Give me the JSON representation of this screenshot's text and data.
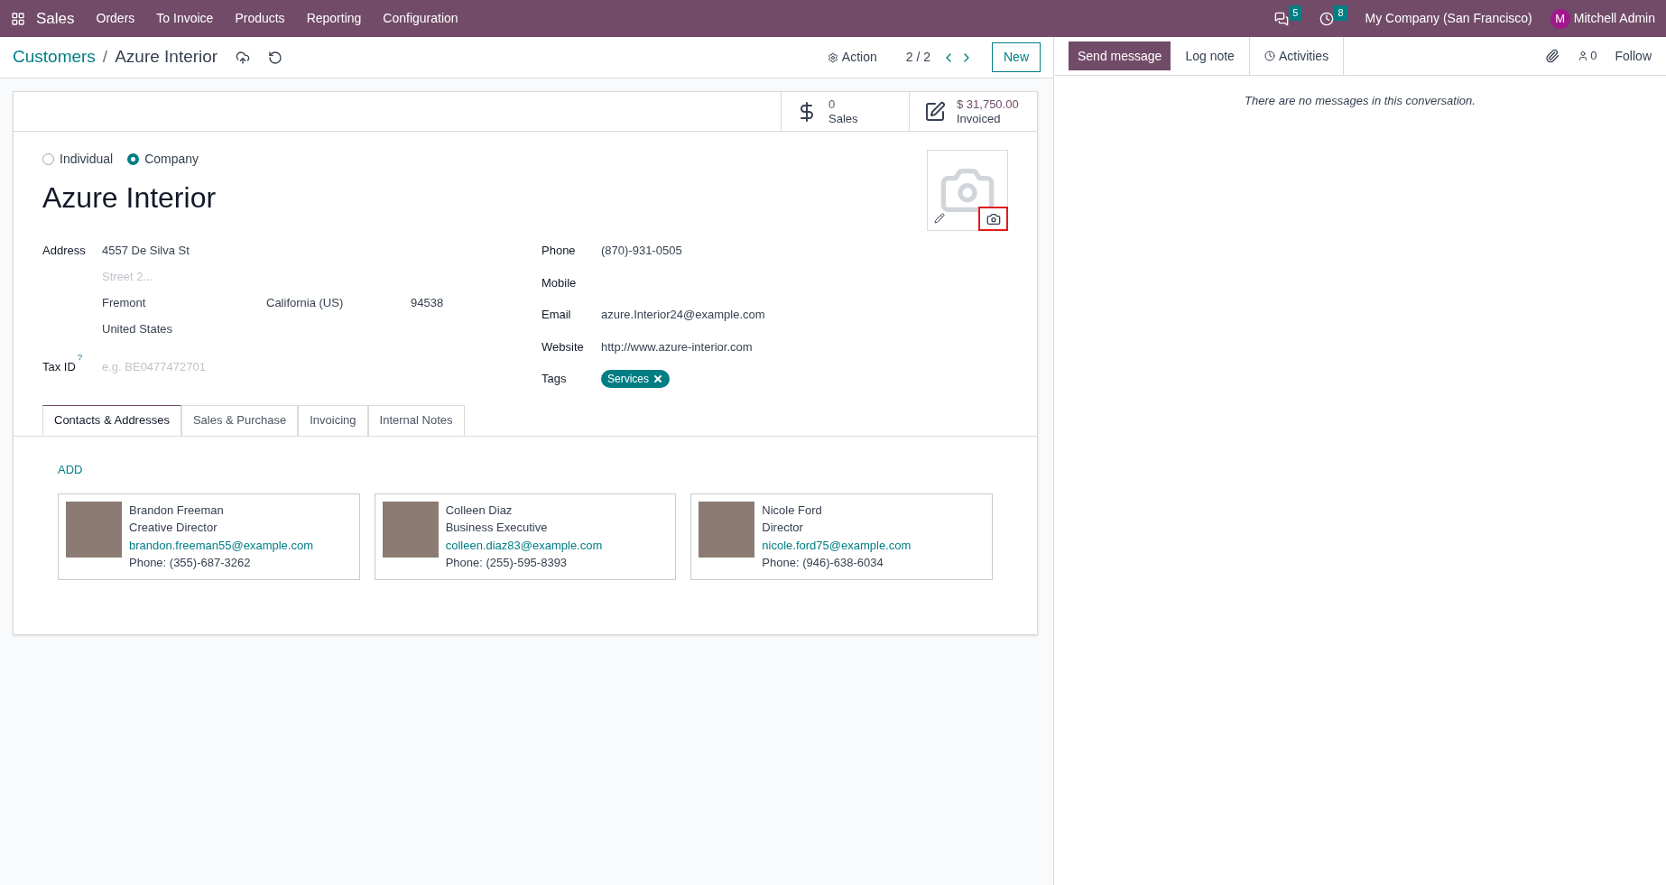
{
  "navbar": {
    "app": "Sales",
    "menu": [
      "Orders",
      "To Invoice",
      "Products",
      "Reporting",
      "Configuration"
    ],
    "messages_count": "5",
    "activities_count": "8",
    "company": "My Company (San Francisco)",
    "user_initial": "M",
    "user": "Mitchell Admin"
  },
  "control_panel": {
    "breadcrumb": "Customers",
    "separator": "/",
    "current": "Azure Interior",
    "action": "Action",
    "pager": "2 / 2",
    "new_button": "New"
  },
  "smart_buttons": [
    {
      "kind": "sales",
      "value": "0",
      "label": "Sales"
    },
    {
      "kind": "invoiced",
      "value": "$ 31,750.00",
      "label": "Invoiced"
    }
  ],
  "company_type": [
    {
      "label": "Individual",
      "selected": false
    },
    {
      "label": "Company",
      "selected": true
    }
  ],
  "name": "Azure Interior",
  "left_fields": {
    "address_label": "Address",
    "street": "4557 De Silva St",
    "street2_placeholder": "Street 2...",
    "city": "Fremont",
    "state": "California (US)",
    "zip": "94538",
    "country": "United States",
    "tax_label": "Tax ID",
    "tax_help": "?",
    "tax_placeholder": "e.g. BE0477472701"
  },
  "right_fields": [
    {
      "label": "Phone",
      "value": "(870)-931-0505"
    },
    {
      "label": "Mobile"
    },
    {
      "label": "Email",
      "value": "azure.Interior24@example.com"
    },
    {
      "label": "Website",
      "value": "http://www.azure-interior.com"
    }
  ],
  "tags_label": "Tags",
  "tags": [
    {
      "label": "Services",
      "color": "#017e84"
    }
  ],
  "tabs": [
    {
      "label": "Contacts & Addresses",
      "selected": true
    },
    {
      "label": "Sales & Purchase",
      "selected": false
    },
    {
      "label": "Invoicing",
      "selected": false
    },
    {
      "label": "Internal Notes",
      "selected": false
    }
  ],
  "add_link": "ADD",
  "contacts": [
    {
      "name": "Brandon Freeman",
      "job": "Creative Director",
      "email": "brandon.freeman55@example.com",
      "phone": "Phone: (355)-687-3262"
    },
    {
      "name": "Colleen Diaz",
      "job": "Business Executive",
      "email": "colleen.diaz83@example.com",
      "phone": "Phone: (255)-595-8393"
    },
    {
      "name": "Nicole Ford",
      "job": "Director",
      "email": "nicole.ford75@example.com",
      "phone": "Phone: (946)-638-6034"
    }
  ],
  "chatter": {
    "send_message": "Send message",
    "log_note": "Log note",
    "activities": "Activities",
    "followers_count": "0",
    "follow": "Follow",
    "empty": "There are no messages in this conversation."
  }
}
